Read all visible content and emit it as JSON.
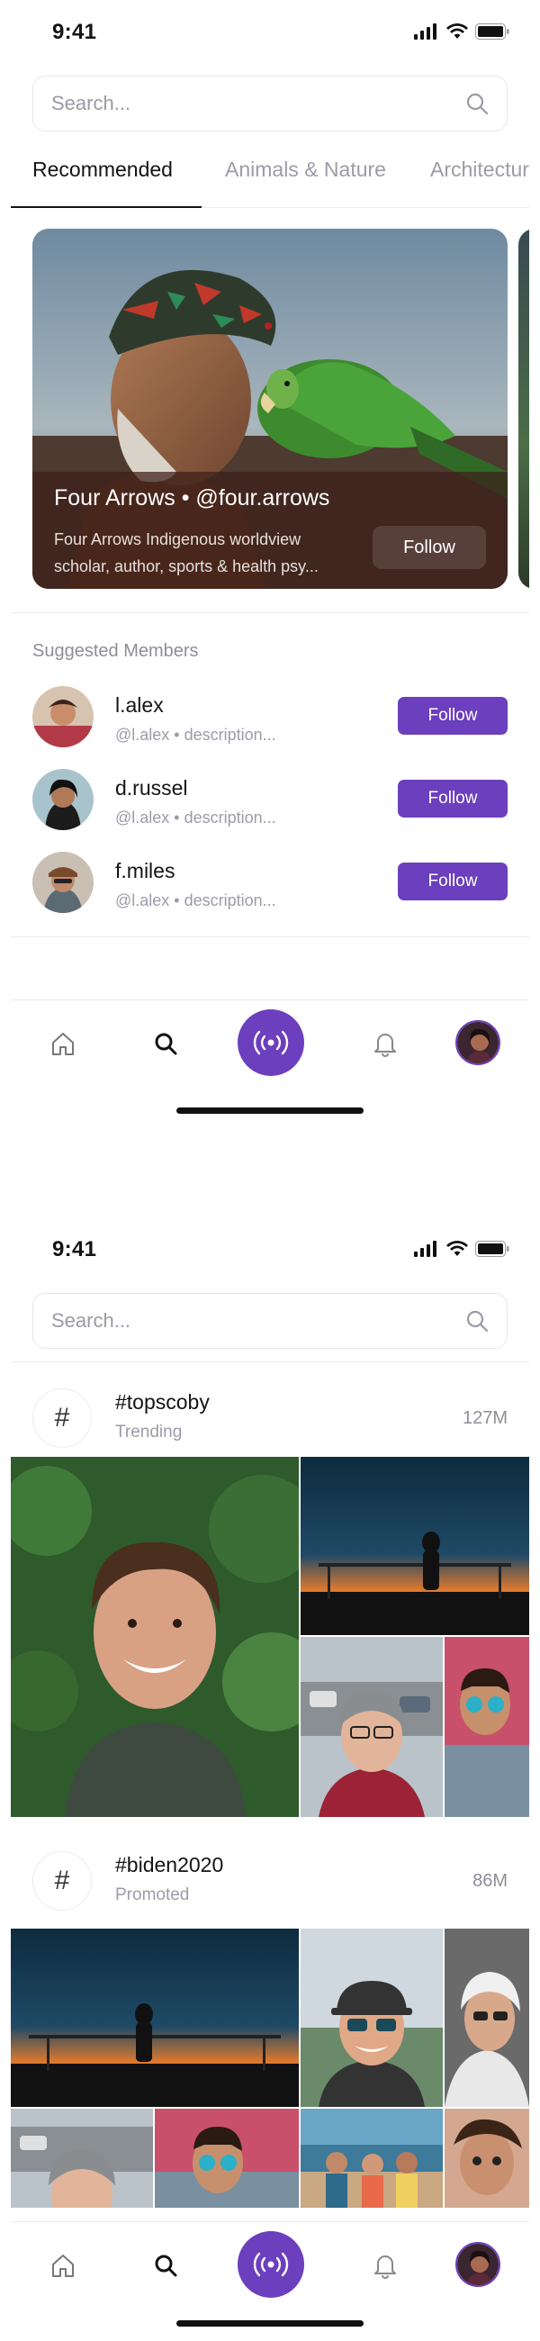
{
  "status": {
    "time": "9:41"
  },
  "search": {
    "placeholder": "Search..."
  },
  "tabs": [
    {
      "label": "Recommended"
    },
    {
      "label": "Animals & Nature"
    },
    {
      "label": "Architectur"
    }
  ],
  "feature": {
    "title": "Four Arrows • @four.arrows",
    "description": "Four Arrows Indigenous worldview scholar, author, sports & health psy...",
    "follow_label": "Follow"
  },
  "suggested": {
    "title": "Suggested Members",
    "members": [
      {
        "name": "l.alex",
        "desc": "@l.alex • description...",
        "follow_label": "Follow"
      },
      {
        "name": "d.russel",
        "desc": "@l.alex • description...",
        "follow_label": "Follow"
      },
      {
        "name": "f.miles",
        "desc": "@l.alex • description...",
        "follow_label": "Follow"
      }
    ]
  },
  "hashtags": [
    {
      "tag": "#topscoby",
      "subtitle": "Trending",
      "count": "127M"
    },
    {
      "tag": "#biden2020",
      "subtitle": "Promoted",
      "count": "86M"
    }
  ],
  "nav": {
    "items": [
      "home-icon",
      "search-icon",
      "live-broadcast-icon",
      "bell-icon",
      "profile-avatar"
    ]
  },
  "colors": {
    "accent": "#6b3fbd",
    "text": "#141414",
    "muted": "#9c9ca8",
    "divider": "#ececf0"
  }
}
